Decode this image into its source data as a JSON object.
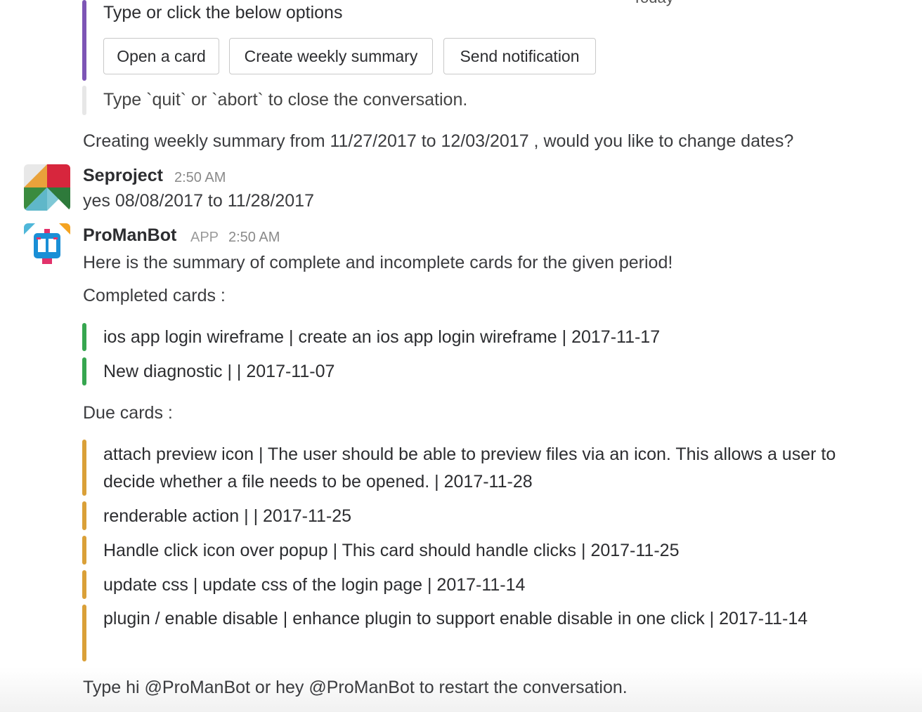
{
  "top_attachment": {
    "faded_label": "Today",
    "prompt": "Type or click the below options",
    "buttons": [
      "Open a card",
      "Create weekly summary",
      "Send notification"
    ],
    "quit_note": "Type `quit` or `abort` to close the conversation."
  },
  "bot_reply_1": "Creating weekly summary from 11/27/2017 to 12/03/2017 , would you like to change dates?",
  "user_message": {
    "sender": "Seproject",
    "time": "2:50 AM",
    "text": "yes 08/08/2017 to 11/28/2017"
  },
  "bot_message": {
    "sender": "ProManBot",
    "app_tag": "APP",
    "time": "2:50 AM",
    "intro": "Here is the summary of complete and incomplete cards for the given period!",
    "completed_heading": "Completed cards :",
    "completed_cards": [
      "ios app login wireframe | create an ios app login wireframe | 2017-11-17",
      "New diagnostic |  | 2017-11-07"
    ],
    "due_heading": "Due cards :",
    "due_cards": [
      "attach preview icon | The user should be able to preview files via an icon. This allows a user to decide whether a file needs to be opened. | 2017-11-28",
      "renderable action |  | 2017-11-25",
      "Handle click icon over popup | This card should handle clicks | 2017-11-25",
      "update css | update css of the login page | 2017-11-14",
      "plugin / enable disable | enhance plugin to support enable disable in one click | 2017-11-14"
    ],
    "footer": "Type hi @ProManBot or hey @ProManBot to restart the conversation."
  },
  "colors": {
    "purple_bar": "#7d55b5",
    "completed_bar": "#36a64f",
    "due_bar": "#daa038"
  }
}
